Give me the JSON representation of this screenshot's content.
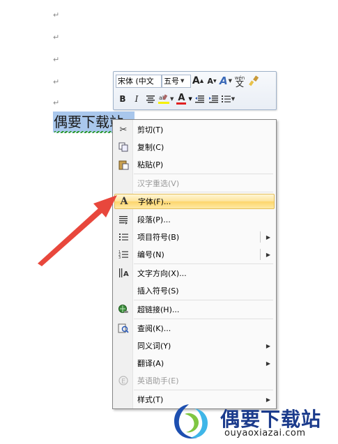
{
  "document": {
    "para_mark": "↵",
    "selected_text": "偶要下载站"
  },
  "mini_toolbar": {
    "font_name": "宋体 (中文",
    "font_size": "五号",
    "grow_font_label": "A",
    "shrink_font_label": "A",
    "styles_label": "A",
    "phonetic_label": "wén",
    "bold_label": "B",
    "italic_label": "I",
    "font_color_label": "A"
  },
  "context_menu": {
    "items": [
      {
        "label": "剪切(T)",
        "icon": "scissors-icon",
        "enabled": true
      },
      {
        "label": "复制(C)",
        "icon": "copy-icon",
        "enabled": true
      },
      {
        "label": "粘贴(P)",
        "icon": "paste-icon",
        "enabled": true
      },
      {
        "label": "汉字重选(V)",
        "icon": "",
        "enabled": false
      },
      {
        "label": "字体(F)...",
        "icon": "font-icon",
        "enabled": true,
        "highlighted": true
      },
      {
        "label": "段落(P)...",
        "icon": "paragraph-icon",
        "enabled": true
      },
      {
        "label": "项目符号(B)",
        "icon": "bullets-icon",
        "enabled": true,
        "submenu": true
      },
      {
        "label": "编号(N)",
        "icon": "numbering-icon",
        "enabled": true,
        "submenu": true
      },
      {
        "label": "文字方向(X)...",
        "icon": "text-direction-icon",
        "enabled": true
      },
      {
        "label": "插入符号(S)",
        "icon": "",
        "enabled": true
      },
      {
        "label": "超链接(H)...",
        "icon": "hyperlink-icon",
        "enabled": true
      },
      {
        "label": "查阅(K)...",
        "icon": "lookup-icon",
        "enabled": true
      },
      {
        "label": "同义词(Y)",
        "icon": "",
        "enabled": true,
        "submenu": true
      },
      {
        "label": "翻译(A)",
        "icon": "",
        "enabled": true,
        "submenu": true
      },
      {
        "label": "英语助手(E)",
        "icon": "english-assistant-icon",
        "enabled": false
      },
      {
        "label": "样式(T)",
        "icon": "",
        "enabled": true,
        "submenu": true
      }
    ]
  },
  "watermark": {
    "site_name": "偶要下载站",
    "url": "ouyaoxiazai.com"
  },
  "colors": {
    "selection": "#a9c7ec",
    "highlight_item": "#fdd56c",
    "arrow": "#e8473c",
    "watermark_text": "#1b3b8c"
  }
}
